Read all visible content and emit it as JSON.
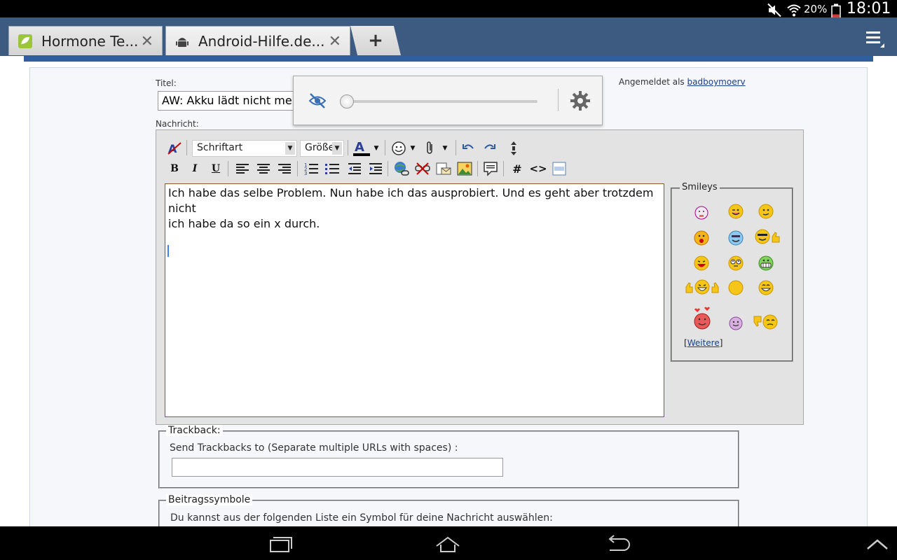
{
  "status_bar": {
    "battery": "20%",
    "time": "18:01"
  },
  "tabs": [
    {
      "title": "Hormone Te...",
      "icon": "leaf-favicon-icon",
      "active": false
    },
    {
      "title": "Android-Hilfe.de...",
      "icon": "android-favicon-icon",
      "active": true
    }
  ],
  "new_tab_label": "+",
  "form": {
    "title_label": "Titel:",
    "title_value": "AW: Akku lädt nicht mehr",
    "message_label": "Nachricht:",
    "login_prefix": "Angemeldet als",
    "login_user": "badboymoerv"
  },
  "toolbar": {
    "font_select": "Schriftart",
    "size_select": "Größe",
    "bold": "B",
    "italic": "I",
    "underline": "U",
    "hash": "#",
    "code": "<>"
  },
  "editor": {
    "text_line1": "Ich habe das selbe Problem. Nun habe ich das ausprobiert. Und es geht aber trotzdem nicht",
    "text_line2": "ich habe da so ein x durch."
  },
  "smileys": {
    "legend": "Smileys",
    "more_link": "Weitere"
  },
  "trackback": {
    "legend": "Trackback:",
    "instruction": "Send Trackbacks to (Separate multiple URLs with spaces) :"
  },
  "post_icons": {
    "legend": "Beitragssymbole",
    "instruction": "Du kannst aus der folgenden Liste ein Symbol für deine Nachricht auswählen:"
  },
  "colors": {
    "tabbar": "#3d5a80",
    "accent_line": "#2f5f9e",
    "link": "#1a3f8a"
  }
}
